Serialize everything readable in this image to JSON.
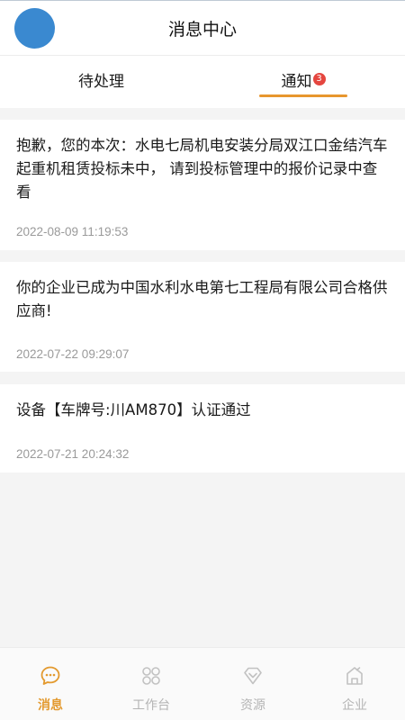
{
  "header": {
    "title": "消息中心",
    "avatar_color": "#3a89d0"
  },
  "tabs": {
    "pending_label": "待处理",
    "notice_label": "通知",
    "notice_badge": "3",
    "active": "notice",
    "accent_color": "#e7962e"
  },
  "messages": [
    {
      "text": "抱歉，您的本次：水电七局机电安装分局双江口金结汽车起重机租赁投标未中， 请到投标管理中的报价记录中查看",
      "time": "2022-08-09 11:19:53"
    },
    {
      "text": "你的企业已成为中国水利水电第七工程局有限公司合格供应商!",
      "time": "2022-07-22 09:29:07"
    },
    {
      "text": "设备【车牌号:川AM870】认证通过",
      "time": "2022-07-21 20:24:32"
    }
  ],
  "tabbar": {
    "items": [
      {
        "label": "消息",
        "icon": "chat-icon",
        "active": true
      },
      {
        "label": "工作台",
        "icon": "grid-icon",
        "active": false
      },
      {
        "label": "资源",
        "icon": "diamond-icon",
        "active": false
      },
      {
        "label": "企业",
        "icon": "building-icon",
        "active": false
      }
    ],
    "active_color": "#e39a2f",
    "inactive_color": "#b4b4b4"
  }
}
